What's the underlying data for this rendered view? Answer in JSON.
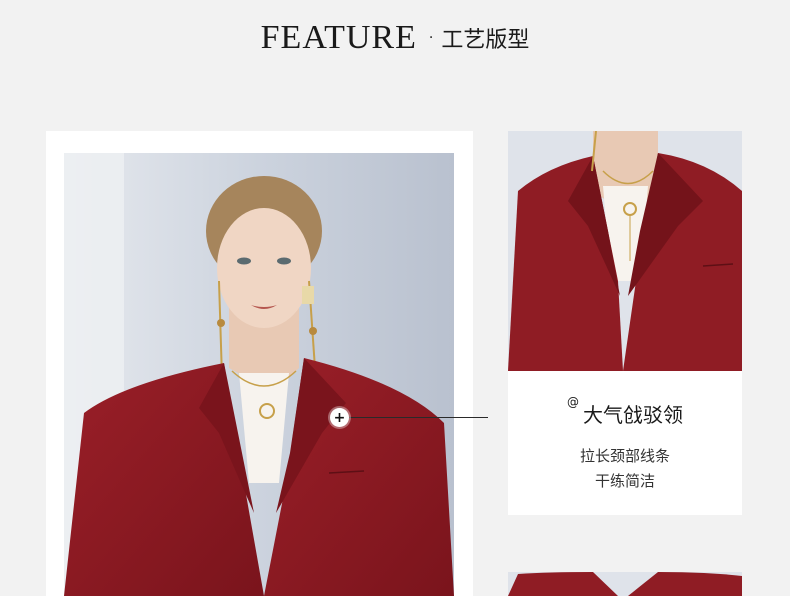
{
  "header": {
    "title_en": "FEATURE",
    "separator": "·",
    "title_cn": "工艺版型"
  },
  "feature": {
    "at_mark": "@",
    "title": "大气戗驳领",
    "line1": "拉长颈部线条",
    "line2": "干练简洁"
  },
  "hotspot": {
    "icon": "plus-icon",
    "symbol": "+"
  },
  "colors": {
    "background": "#f2f2f2",
    "card": "#ffffff",
    "blazer": "#8f1c24",
    "text": "#1a1a1a"
  }
}
